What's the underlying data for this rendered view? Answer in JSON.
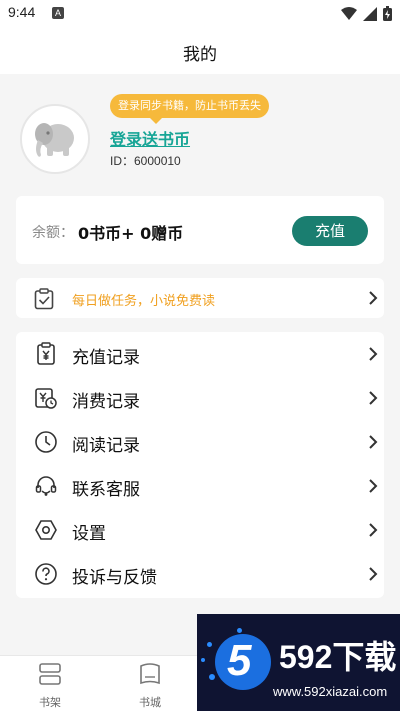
{
  "status": {
    "time": "9:44",
    "notif_letter": "A"
  },
  "header": {
    "title": "我的"
  },
  "profile": {
    "tooltip": "登录同步书籍，防止书币丢失",
    "login_text": "登录送书币",
    "id_text": "ID：6000010"
  },
  "balance": {
    "label": "余额：",
    "value": "0书币+ 0赠币",
    "button": "充值"
  },
  "task": {
    "text": "每日做任务，小说免费读"
  },
  "menu": {
    "items": [
      {
        "label": "充值记录",
        "icon": "recharge-record-icon"
      },
      {
        "label": "消费记录",
        "icon": "consume-record-icon"
      },
      {
        "label": "阅读记录",
        "icon": "clock-icon"
      },
      {
        "label": "联系客服",
        "icon": "headset-icon"
      },
      {
        "label": "设置",
        "icon": "settings-icon"
      },
      {
        "label": "投诉与反馈",
        "icon": "help-icon"
      }
    ]
  },
  "tabs": [
    {
      "label": "书架",
      "icon": "bookshelf-icon"
    },
    {
      "label": "书城",
      "icon": "bookstore-icon"
    }
  ],
  "watermark": {
    "number": "5",
    "title": "592下载",
    "url": "www.592xiazai.com"
  },
  "colors": {
    "accent": "#17a596",
    "button": "#1a7e70",
    "tooltip": "#f6b93b",
    "task_text": "#f0a020"
  }
}
